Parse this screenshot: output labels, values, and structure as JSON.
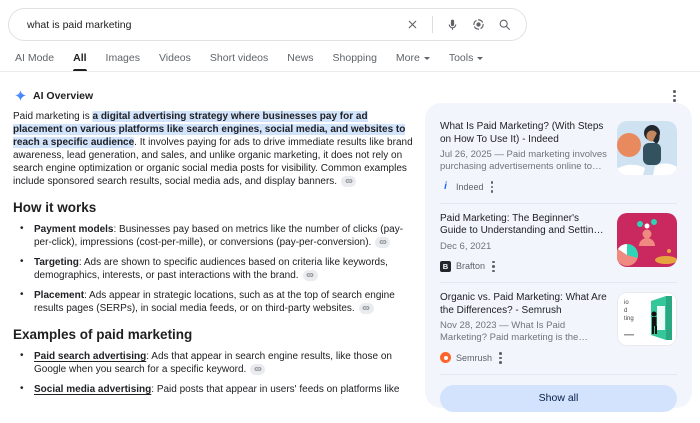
{
  "search_bar": {
    "query": "what is paid marketing"
  },
  "tabs": {
    "items": [
      {
        "label": "AI Mode"
      },
      {
        "label": "All"
      },
      {
        "label": "Images"
      },
      {
        "label": "Videos"
      },
      {
        "label": "Short videos"
      },
      {
        "label": "News"
      },
      {
        "label": "Shopping"
      },
      {
        "label": "More"
      },
      {
        "label": "Tools"
      }
    ]
  },
  "ai_overview": {
    "label": "AI Overview",
    "intro_prefix": "Paid marketing is ",
    "intro_highlight": "a digital advertising strategy where businesses pay for ad placement on various platforms like search engines, social media, and websites to reach a specific audience",
    "intro_suffix": ". It involves paying for ads to drive immediate results like brand awareness, lead generation, and sales, and unlike organic marketing, it does not rely on search engine optimization or organic social media posts for visibility. Common examples include sponsored search results, social media ads, and display banners.",
    "sections": [
      {
        "heading": "How it works",
        "bullets": [
          {
            "term": "Payment models",
            "text": ": Businesses pay based on metrics like the number of clicks (pay-per-click), impressions (cost-per-mille), or conversions (pay-per-conversion)."
          },
          {
            "term": "Targeting",
            "text": ": Ads are shown to specific audiences based on criteria like keywords, demographics, interests, or past interactions with the brand."
          },
          {
            "term": "Placement",
            "text": ": Ads appear in strategic locations, such as at the top of search engine results pages (SERPs), in social media feeds, or on third-party websites."
          }
        ]
      },
      {
        "heading": "Examples of paid marketing",
        "bullets": [
          {
            "term": "Paid search advertising",
            "text": ": Ads that appear in search engine results, like those on Google when you search for a specific keyword."
          },
          {
            "term": "Social media advertising",
            "text": ": Paid posts that appear in users' feeds on platforms like"
          }
        ]
      }
    ]
  },
  "sources_panel": {
    "cards": [
      {
        "title": "What Is Paid Marketing? (With Steps on How To Use It) - Indeed",
        "snippet": "Jul 26, 2025 — Paid marketing involves purchasing advertisements online to help...",
        "source": "Indeed",
        "favicon_letter": "i"
      },
      {
        "title": "Paid Marketing: The Beginner's Guide to Understanding and Setting Up a Paid...",
        "snippet": "Dec 6, 2021",
        "source": "Brafton",
        "favicon_letter": "B"
      },
      {
        "title": "Organic vs. Paid Marketing: What Are the Differences? - Semrush",
        "snippet": "Nov 28, 2023 — What Is Paid Marketing? Paid marketing is the process of using paid...",
        "source": "Semrush",
        "thumb_text_lines": {
          "0": "io",
          "1": "d",
          "2": "ting"
        }
      }
    ],
    "show_all_label": "Show all"
  },
  "colors": {
    "highlight_bg": "#d2e3fc",
    "panel_bg": "#f2f6fc",
    "show_all_bg": "#d3e3fd",
    "active_tab_underline": "#202124",
    "icon_gray": "#5f6368",
    "sparkle_blue": "#1b6ef3"
  }
}
